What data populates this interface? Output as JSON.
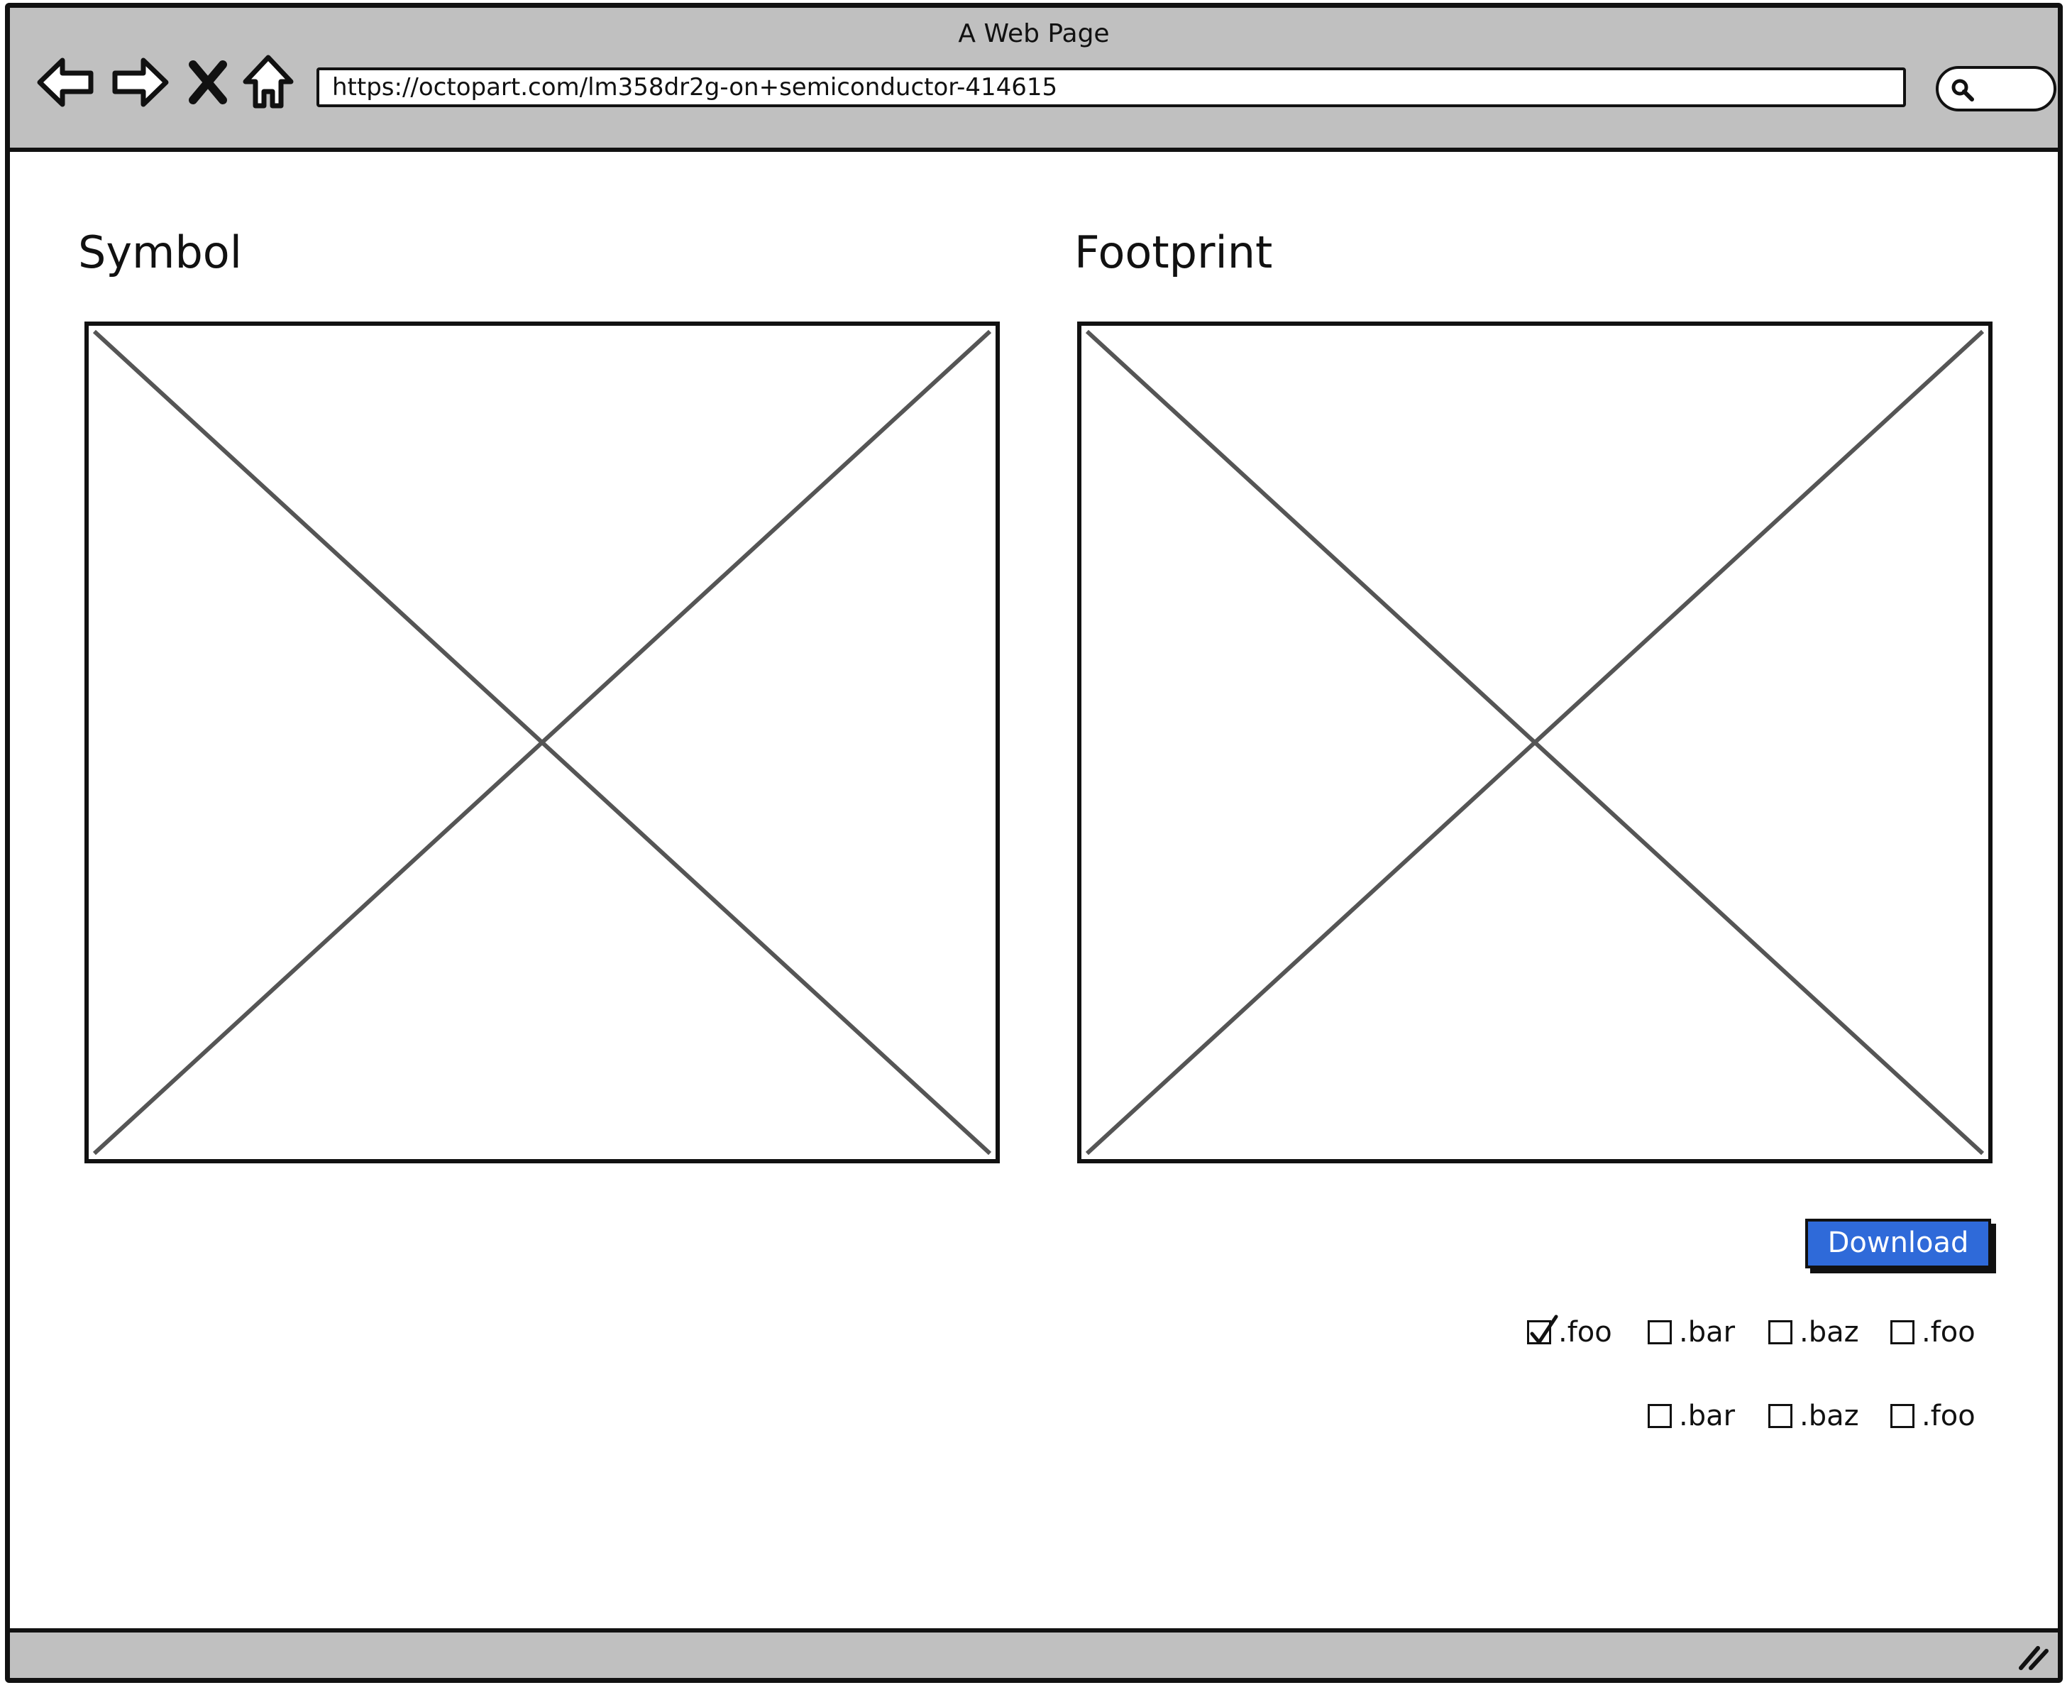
{
  "window": {
    "title": "A Web Page"
  },
  "toolbar": {
    "back_icon": "back-arrow-icon",
    "forward_icon": "forward-arrow-icon",
    "stop_icon": "close-x-icon",
    "home_icon": "home-icon",
    "search_icon": "search-icon"
  },
  "address_bar": {
    "url": "https://octopart.com/lm358dr2g-on+semiconductor-414615"
  },
  "symbol": {
    "heading": "Symbol"
  },
  "footprint": {
    "heading": "Footprint"
  },
  "download": {
    "label": "Download",
    "color": "#2f6ad9"
  },
  "formats": {
    "row1": [
      {
        "label": ".foo",
        "checked": true
      },
      {
        "label": ".bar",
        "checked": false
      },
      {
        "label": ".baz",
        "checked": false
      },
      {
        "label": ".foo",
        "checked": false
      }
    ],
    "row2": [
      {
        "label": ".bar",
        "checked": false
      },
      {
        "label": ".baz",
        "checked": false
      },
      {
        "label": ".foo",
        "checked": false
      }
    ]
  }
}
